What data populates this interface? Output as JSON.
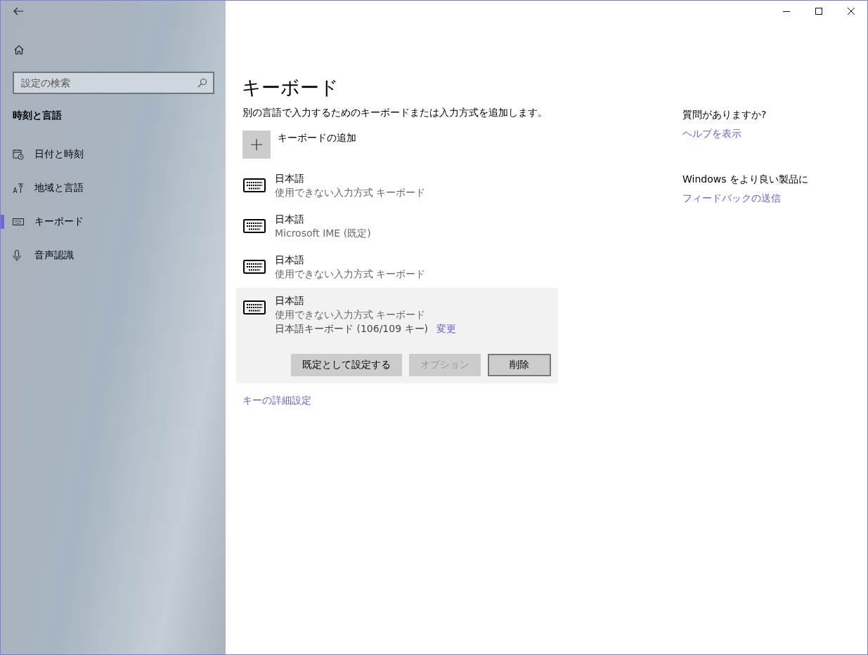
{
  "sidebar": {
    "search": {
      "placeholder": "設定の検索"
    },
    "section_title": "時刻と言語",
    "items": [
      {
        "kind": "calendar",
        "label": "日付と時刻",
        "selected": false
      },
      {
        "kind": "language",
        "label": "地域と言語",
        "selected": false
      },
      {
        "kind": "keyboard",
        "label": "キーボード",
        "selected": true
      },
      {
        "kind": "microphone",
        "label": "音声認識",
        "selected": false
      }
    ]
  },
  "page": {
    "title": "キーボード",
    "description": "別の言語で入力するためのキーボードまたは入力方式を追加します。",
    "add_label": "キーボードの追加",
    "keyboards": [
      {
        "name": "日本語",
        "method": "使用できない入力方式 キーボード",
        "selected": false
      },
      {
        "name": "日本語",
        "method": "Microsoft IME (既定)",
        "selected": false
      },
      {
        "name": "日本語",
        "method": "使用できない入力方式 キーボード",
        "selected": false
      },
      {
        "name": "日本語",
        "method": "使用できない入力方式 キーボード",
        "selected": true,
        "layout": "日本語キーボード (106/109 キー)",
        "layout_link": "変更",
        "buttons": [
          {
            "label": "既定として設定する",
            "disabled": false,
            "focused": false
          },
          {
            "label": "オプション",
            "disabled": true,
            "focused": false
          },
          {
            "label": "削除",
            "disabled": false,
            "focused": true
          }
        ]
      }
    ],
    "advanced_link": "キーの詳細設定"
  },
  "aside": [
    {
      "heading": "質問がありますか?",
      "link": "ヘルプを表示"
    },
    {
      "heading": "Windows をより良い製品に",
      "link": "フィードバックの送信"
    }
  ]
}
